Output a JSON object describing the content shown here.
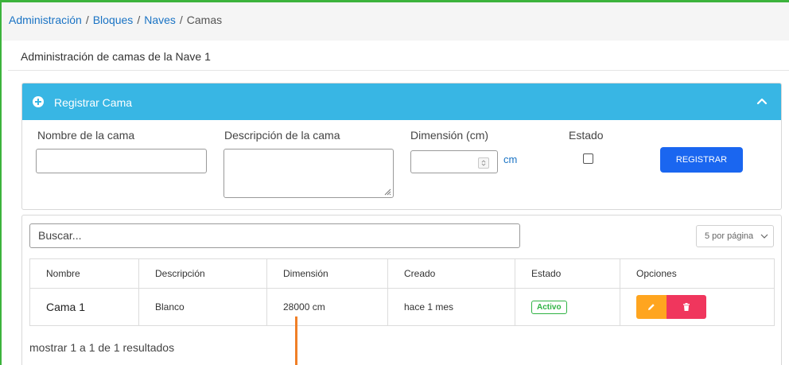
{
  "breadcrumb": {
    "items": [
      "Administración",
      "Bloques",
      "Naves"
    ],
    "current": "Camas",
    "separator": "/"
  },
  "page": {
    "title": "Administración de camas de la Nave 1"
  },
  "register_panel": {
    "title": "Registrar Cama",
    "fields": {
      "name": {
        "label": "Nombre de la cama",
        "value": ""
      },
      "description": {
        "label": "Descripción de la cama",
        "value": ""
      },
      "dimension": {
        "label": "Dimensión (cm)",
        "value": "",
        "unit": "cm"
      },
      "status": {
        "label": "Estado",
        "checked": false
      }
    },
    "submit_label": "REGISTRAR"
  },
  "list": {
    "search_placeholder": "Buscar...",
    "page_size_label": "5 por página",
    "columns": [
      "Nombre",
      "Descripción",
      "Dimensión",
      "Creado",
      "Estado",
      "Opciones"
    ],
    "rows": [
      {
        "name": "Cama 1",
        "description": "Blanco",
        "dimension": "28000 cm",
        "created": "hace 1 mes",
        "status": "Activo"
      }
    ],
    "results_text": "mostrar 1 a 1 de 1 resultados"
  },
  "colors": {
    "accent_header": "#38b6e4",
    "primary_button": "#1a66f0",
    "edit_button": "#ffa51f",
    "delete_button": "#f0365d",
    "status_active": "#2fb344",
    "link": "#1a73c4"
  },
  "icons": {
    "panel_header": "plus-circle-icon",
    "collapse": "chevron-up-icon",
    "edit": "pencil-icon",
    "delete": "trash-icon"
  }
}
